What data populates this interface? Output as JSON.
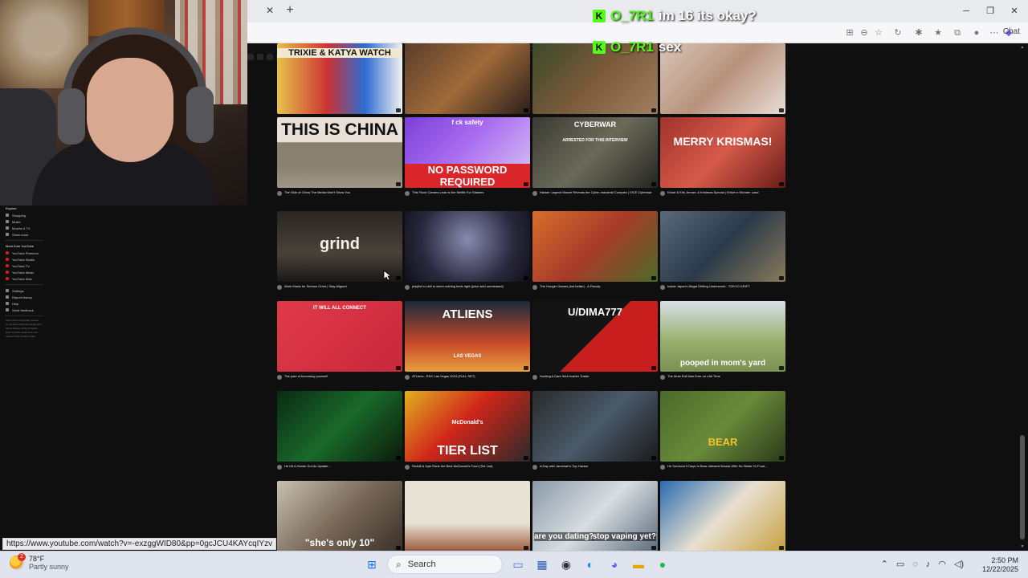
{
  "overlay_chat": [
    {
      "badge": "K",
      "user": "O_7R1",
      "message": "im 16 its okay?"
    },
    {
      "badge": "K",
      "user": "O_7R1",
      "message": "sex"
    }
  ],
  "browser": {
    "chat_label": "Chat"
  },
  "status_url": "https://www.youtube.com/watch?v=-exzggWID80&pp=0gcJCU4KAYcqIYzv",
  "videos": [
    {
      "thumb_text": "TRIXIE & KATYA WATCH",
      "title": "Drag Queens Trixie Mattel & Katya React to The Hunting Wives | Video To Watch | Netflix"
    },
    {
      "thumb_text": "",
      "title": "I'm Obsessed Rich People with a Fake Art Gallery"
    },
    {
      "thumb_text": "",
      "title": "Build Himself a Tree House in the Mountains Alone"
    },
    {
      "thumb_text": "",
      "title": "We're FINALLY Able to Talk About This (Ep. 89)"
    },
    {
      "thumb_text": "THIS IS CHINA",
      "title": "The Side of China The Media Won't Show You"
    },
    {
      "thumb_text": "NO PASSWORD REQUIRED",
      "thumb_text2": "f ck safety",
      "title": "This Flock Camera Leak is like Netflix For Stalkers"
    },
    {
      "thumb_text": "CYBERWAR",
      "thumb_text2": "ARRESTED FOR THIS INTERVIEW",
      "title": "Hacker Legend Marcel Reveals the Cyber-Industrial Complex | VICE Cyberwar"
    },
    {
      "thumb_text": "MERRY KRISMAS!",
      "title": "Khloé & Kris Jenner: A Kristmas Special | Khloé in Wonder Land"
    },
    {
      "thumb_text": "grind",
      "title": "Work Music for Serious Grind | Stay Aligned"
    },
    {
      "thumb_text": "",
      "title": "playlist to chill to when nothing feels right (juice wrld unreleased)"
    },
    {
      "thumb_text": "",
      "title": "The Hunger Games (but better) - A Parody"
    },
    {
      "thumb_text": "",
      "title": "Inside Japan's Illegal Drifting Underworld - TOKYO DRIFT"
    },
    {
      "thumb_text": "IT WILL ALL CONNECT",
      "title": "The pain of becoming yourself"
    },
    {
      "thumb_text": "ATLIENS",
      "thumb_text2": "LAS VEGAS",
      "title": "ATLiens - EDC Las Vegas 2024 (FULL SET)"
    },
    {
      "thumb_text": "U/DIMA777",
      "title": "Hunting A Dark Web Insider Trader"
    },
    {
      "thumb_text": "pooped in mom's yard",
      "title": "The Most Evil Man Ever on r/All Time"
    },
    {
      "thumb_text": "",
      "title": "He Hit A Homie Got An Update..."
    },
    {
      "thumb_text": "TIER LIST",
      "thumb_text2": "McDonald's",
      "title": "Reddit & Kyle Rank the Best McDonald's Food (Tier List)"
    },
    {
      "thumb_text": "",
      "title": "A Day with Jameriah's Top Hacker"
    },
    {
      "thumb_text": "BEAR",
      "title": "He Survived 3 Days In Bear-Infested Woods With No Water Or Food..."
    },
    {
      "thumb_text": "\"she's only 10\"",
      "title": ""
    },
    {
      "thumb_text": "",
      "title": ""
    },
    {
      "thumb_text": "are you dating?",
      "thumb_text2": "stop vaping yet?",
      "title": ""
    },
    {
      "thumb_text": "",
      "title": ""
    }
  ],
  "sidebar": {
    "explore_head": "Explore",
    "explore": [
      "Shopping",
      "Music",
      "Movies & TV",
      "Show more"
    ],
    "more_head": "More from YouTube",
    "more": [
      "YouTube Premium",
      "YouTube Studio",
      "YouTube TV",
      "YouTube Music",
      "YouTube Kids"
    ],
    "settings": [
      "Settings",
      "Report history",
      "Help",
      "Send feedback"
    ],
    "footer": "About Press Copyright Contact us Creators Advertise Developers Terms Privacy Policy & Safety How YouTube works Test new features NFL Sunday Ticket"
  },
  "taskbar": {
    "temperature": "78°F",
    "condition": "Partly sunny",
    "weather_badge": "2",
    "search_label": "Search",
    "time": "2:50 PM",
    "date": "12/22/2025"
  }
}
